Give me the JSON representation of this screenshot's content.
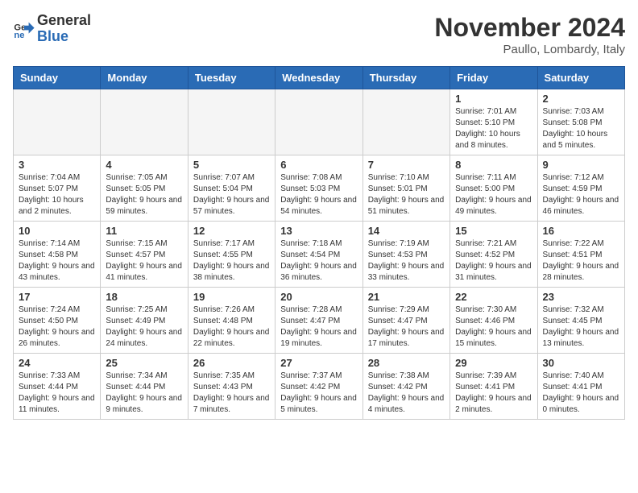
{
  "header": {
    "logo_general": "General",
    "logo_blue": "Blue",
    "month_title": "November 2024",
    "location": "Paullo, Lombardy, Italy"
  },
  "days_of_week": [
    "Sunday",
    "Monday",
    "Tuesday",
    "Wednesday",
    "Thursday",
    "Friday",
    "Saturday"
  ],
  "weeks": [
    [
      {
        "day": "",
        "info": ""
      },
      {
        "day": "",
        "info": ""
      },
      {
        "day": "",
        "info": ""
      },
      {
        "day": "",
        "info": ""
      },
      {
        "day": "",
        "info": ""
      },
      {
        "day": "1",
        "info": "Sunrise: 7:01 AM\nSunset: 5:10 PM\nDaylight: 10 hours and 8 minutes."
      },
      {
        "day": "2",
        "info": "Sunrise: 7:03 AM\nSunset: 5:08 PM\nDaylight: 10 hours and 5 minutes."
      }
    ],
    [
      {
        "day": "3",
        "info": "Sunrise: 7:04 AM\nSunset: 5:07 PM\nDaylight: 10 hours and 2 minutes."
      },
      {
        "day": "4",
        "info": "Sunrise: 7:05 AM\nSunset: 5:05 PM\nDaylight: 9 hours and 59 minutes."
      },
      {
        "day": "5",
        "info": "Sunrise: 7:07 AM\nSunset: 5:04 PM\nDaylight: 9 hours and 57 minutes."
      },
      {
        "day": "6",
        "info": "Sunrise: 7:08 AM\nSunset: 5:03 PM\nDaylight: 9 hours and 54 minutes."
      },
      {
        "day": "7",
        "info": "Sunrise: 7:10 AM\nSunset: 5:01 PM\nDaylight: 9 hours and 51 minutes."
      },
      {
        "day": "8",
        "info": "Sunrise: 7:11 AM\nSunset: 5:00 PM\nDaylight: 9 hours and 49 minutes."
      },
      {
        "day": "9",
        "info": "Sunrise: 7:12 AM\nSunset: 4:59 PM\nDaylight: 9 hours and 46 minutes."
      }
    ],
    [
      {
        "day": "10",
        "info": "Sunrise: 7:14 AM\nSunset: 4:58 PM\nDaylight: 9 hours and 43 minutes."
      },
      {
        "day": "11",
        "info": "Sunrise: 7:15 AM\nSunset: 4:57 PM\nDaylight: 9 hours and 41 minutes."
      },
      {
        "day": "12",
        "info": "Sunrise: 7:17 AM\nSunset: 4:55 PM\nDaylight: 9 hours and 38 minutes."
      },
      {
        "day": "13",
        "info": "Sunrise: 7:18 AM\nSunset: 4:54 PM\nDaylight: 9 hours and 36 minutes."
      },
      {
        "day": "14",
        "info": "Sunrise: 7:19 AM\nSunset: 4:53 PM\nDaylight: 9 hours and 33 minutes."
      },
      {
        "day": "15",
        "info": "Sunrise: 7:21 AM\nSunset: 4:52 PM\nDaylight: 9 hours and 31 minutes."
      },
      {
        "day": "16",
        "info": "Sunrise: 7:22 AM\nSunset: 4:51 PM\nDaylight: 9 hours and 28 minutes."
      }
    ],
    [
      {
        "day": "17",
        "info": "Sunrise: 7:24 AM\nSunset: 4:50 PM\nDaylight: 9 hours and 26 minutes."
      },
      {
        "day": "18",
        "info": "Sunrise: 7:25 AM\nSunset: 4:49 PM\nDaylight: 9 hours and 24 minutes."
      },
      {
        "day": "19",
        "info": "Sunrise: 7:26 AM\nSunset: 4:48 PM\nDaylight: 9 hours and 22 minutes."
      },
      {
        "day": "20",
        "info": "Sunrise: 7:28 AM\nSunset: 4:47 PM\nDaylight: 9 hours and 19 minutes."
      },
      {
        "day": "21",
        "info": "Sunrise: 7:29 AM\nSunset: 4:47 PM\nDaylight: 9 hours and 17 minutes."
      },
      {
        "day": "22",
        "info": "Sunrise: 7:30 AM\nSunset: 4:46 PM\nDaylight: 9 hours and 15 minutes."
      },
      {
        "day": "23",
        "info": "Sunrise: 7:32 AM\nSunset: 4:45 PM\nDaylight: 9 hours and 13 minutes."
      }
    ],
    [
      {
        "day": "24",
        "info": "Sunrise: 7:33 AM\nSunset: 4:44 PM\nDaylight: 9 hours and 11 minutes."
      },
      {
        "day": "25",
        "info": "Sunrise: 7:34 AM\nSunset: 4:44 PM\nDaylight: 9 hours and 9 minutes."
      },
      {
        "day": "26",
        "info": "Sunrise: 7:35 AM\nSunset: 4:43 PM\nDaylight: 9 hours and 7 minutes."
      },
      {
        "day": "27",
        "info": "Sunrise: 7:37 AM\nSunset: 4:42 PM\nDaylight: 9 hours and 5 minutes."
      },
      {
        "day": "28",
        "info": "Sunrise: 7:38 AM\nSunset: 4:42 PM\nDaylight: 9 hours and 4 minutes."
      },
      {
        "day": "29",
        "info": "Sunrise: 7:39 AM\nSunset: 4:41 PM\nDaylight: 9 hours and 2 minutes."
      },
      {
        "day": "30",
        "info": "Sunrise: 7:40 AM\nSunset: 4:41 PM\nDaylight: 9 hours and 0 minutes."
      }
    ]
  ]
}
